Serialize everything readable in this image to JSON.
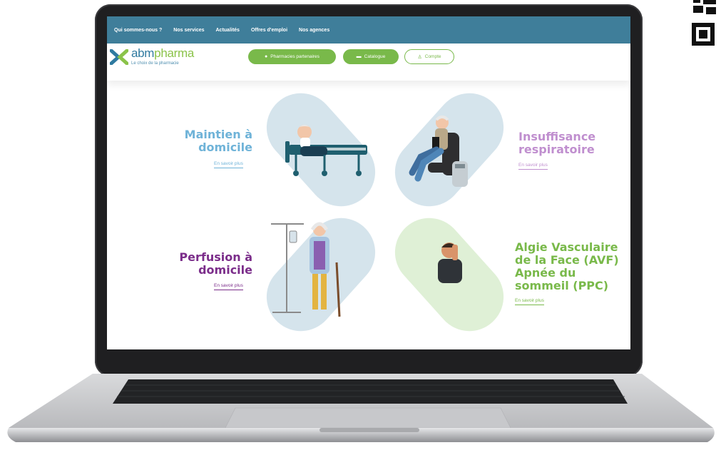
{
  "site": {
    "nav": [
      "Qui sommes-nous ?",
      "Nos services",
      "Actualités",
      "Offres d'emploi",
      "Nos agences"
    ],
    "logo": {
      "name_a": "abm",
      "name_b": "pharma",
      "tagline": "Le choix de la pharmacie"
    },
    "buttons": {
      "pharmacies": "Pharmacies partenaires",
      "catalogue": "Catalogue",
      "compte": "Compte"
    }
  },
  "services": [
    {
      "title_l1": "Maintien à",
      "title_l2": "domicile",
      "link": "En savoir plus",
      "color": "#6fb3d8"
    },
    {
      "title_l1": "Insuffisance",
      "title_l2": "respiratoire",
      "link": "En savoir plus",
      "color": "#c08fcf"
    },
    {
      "title_l1": "Perfusion à",
      "title_l2": "domicile",
      "link": "En savoir plus",
      "color": "#7b2d8a"
    },
    {
      "title_l1": "Algie Vasculaire",
      "title_l2": "de la Face (AVF)",
      "title_l3": "Apnée du",
      "title_l4": "sommeil (PPC)",
      "link": "En savoir plus",
      "color": "#79b94a"
    }
  ],
  "colors": {
    "nav_bg": "#3f7e9a",
    "accent_green": "#79b94a",
    "blob_blue": "#d5e4ec",
    "blob_green": "#dff0d6"
  }
}
